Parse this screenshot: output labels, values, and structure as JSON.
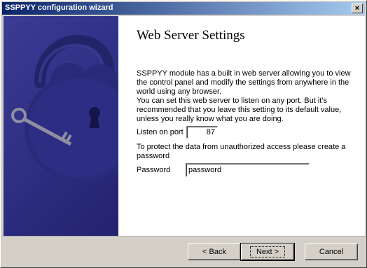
{
  "window": {
    "title": "SSPPYY configuration wizard",
    "close_label": "×"
  },
  "page": {
    "heading": "Web Server Settings",
    "intro_text": "SSPPYY module has a built in web server allowing you to view the control panel and modify the settings from anywhere in the world using any browser.",
    "port_text": "You can set this web server to listen on any port. But it's recommended that you leave this setting to its default value, unless you really know what you are doing.",
    "port_label": "Listen on port",
    "port_value": "87",
    "password_text": "To protect the data from unauthorized access please create a password",
    "password_label": "Password",
    "password_value": "password"
  },
  "buttons": {
    "back": "< Back",
    "next": "Next >",
    "cancel": "Cancel"
  },
  "sidebar": {
    "illustration": "padlock-key-icon"
  }
}
